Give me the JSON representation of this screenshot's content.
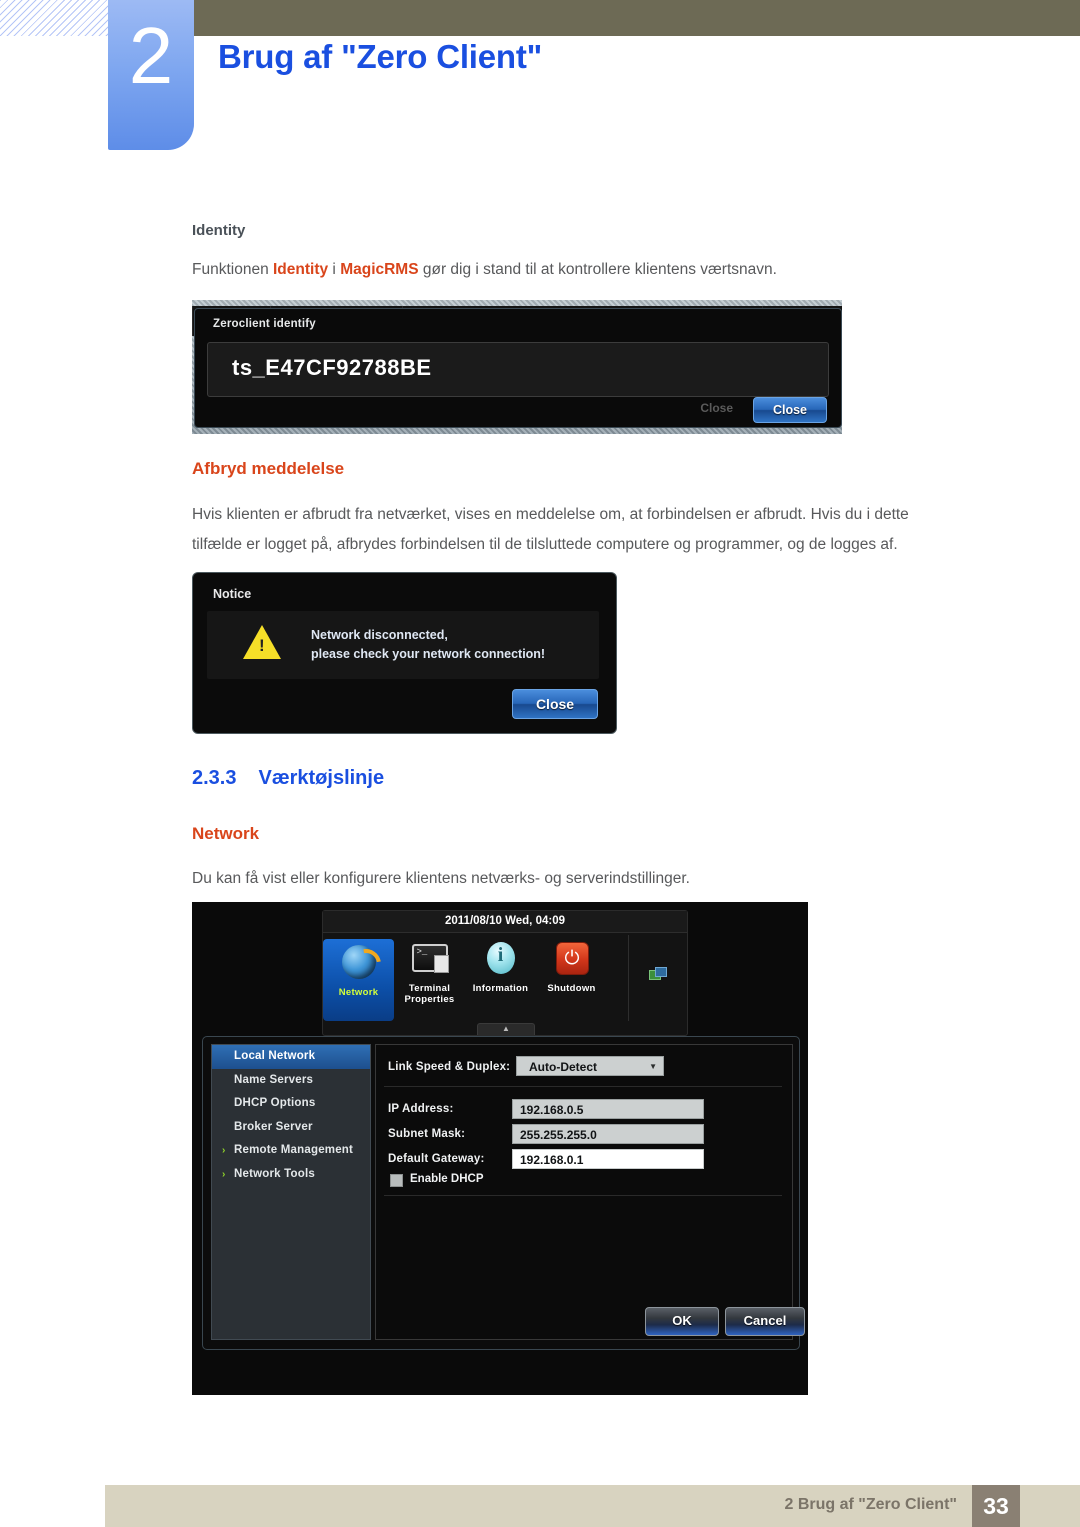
{
  "header": {
    "chapter_number": "2",
    "chapter_title": "Brug af \"Zero Client\"",
    "accent_blue": "#1a4fe0",
    "tab_blue": "#7fa7f0",
    "olive": "#6d6a55"
  },
  "sections": {
    "identity": {
      "heading": "Identity",
      "paragraph_before": "Funktionen ",
      "hl1": "Identity",
      "paragraph_mid": " i ",
      "hl2": "MagicRMS",
      "paragraph_after": " gør dig i stand til at kontrollere klientens værtsnavn."
    },
    "afbryd": {
      "heading": "Afbryd meddelelse",
      "paragraph_line1": "Hvis klienten er afbrudt fra netværket, vises en meddelelse om, at forbindelsen er afbrudt. Hvis du i dette",
      "paragraph_line2": "tilfælde er logget på, afbrydes forbindelsen til de tilsluttede computere og programmer, og de logges af."
    },
    "toolbar_section": {
      "number": "2.3.3",
      "title": "Værktøjslinje",
      "subheading": "Network",
      "paragraph": "Du kan få vist eller konfigurere klientens netværks- og serverindstillinger."
    }
  },
  "screenshot_identity": {
    "dialog_title": "Zeroclient identify",
    "host_value": "ts_E47CF92788BE",
    "ghost_button": "Close",
    "close_button": "Close"
  },
  "screenshot_notice": {
    "dialog_title": "Notice",
    "message_line1": "Network disconnected,",
    "message_line2": "please check your network connection!",
    "close_button": "Close",
    "warning_icon": "warning-triangle-icon"
  },
  "screenshot_network": {
    "clock": "2011/08/10 Wed, 04:09",
    "toolbar_items": [
      {
        "label": "Network",
        "icon": "globe-icon",
        "active": true
      },
      {
        "label_line1": "Terminal",
        "label_line2": "Properties",
        "icon": "terminal-icon",
        "active": false
      },
      {
        "label": "Information",
        "icon": "info-icon",
        "active": false
      },
      {
        "label": "Shutdown",
        "icon": "power-icon",
        "active": false
      }
    ],
    "tray_icon": "network-tray-icon",
    "handle_glyph": "▲",
    "nav_items": [
      {
        "label": "Local Network",
        "selected": true,
        "expandable": false
      },
      {
        "label": "Name Servers",
        "selected": false,
        "expandable": false
      },
      {
        "label": "DHCP Options",
        "selected": false,
        "expandable": false
      },
      {
        "label": "Broker Server",
        "selected": false,
        "expandable": false
      },
      {
        "label": "Remote Management",
        "selected": false,
        "expandable": true
      },
      {
        "label": "Network Tools",
        "selected": false,
        "expandable": true
      }
    ],
    "arrow_glyph": "›",
    "fields": {
      "link_speed_label": "Link Speed & Duplex:",
      "link_speed_value": "Auto-Detect",
      "link_speed_caret": "▼",
      "ip_label": "IP Address:",
      "ip_value": "192.168.0.5",
      "subnet_label": "Subnet Mask:",
      "subnet_value": "255.255.255.0",
      "gateway_label": "Default Gateway:",
      "gateway_value": "192.168.0.1",
      "dhcp_label": "Enable DHCP"
    },
    "ok_button": "OK",
    "cancel_button": "Cancel"
  },
  "footer": {
    "text": "2 Brug af \"Zero Client\"",
    "page_number": "33",
    "bar_color": "#d8d3c0",
    "page_box_color": "#8a8073"
  }
}
